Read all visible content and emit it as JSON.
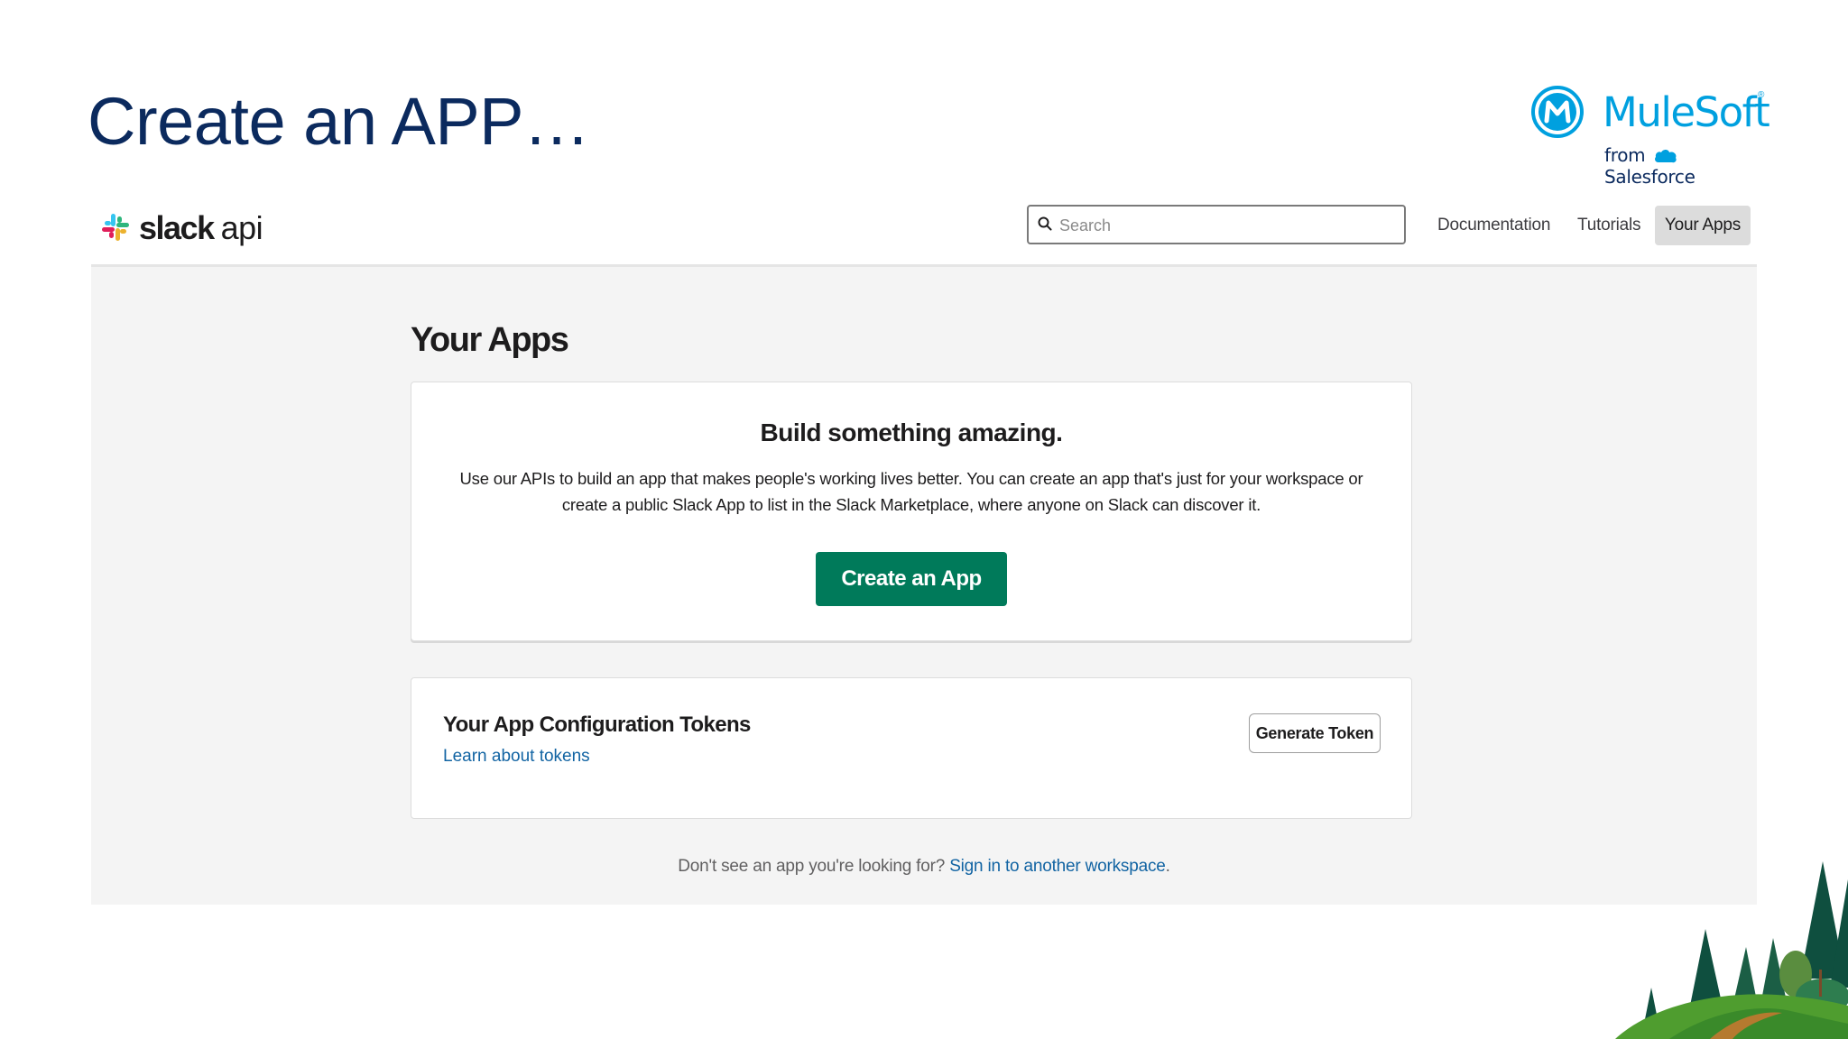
{
  "slide": {
    "title": "Create an APP…",
    "logo": {
      "name": "MuleSoft",
      "from_text": "from",
      "company": "Salesforce"
    }
  },
  "slack": {
    "brand": "slack",
    "brand_suffix": "api",
    "search": {
      "placeholder": "Search",
      "value": ""
    },
    "nav": {
      "documentation": "Documentation",
      "tutorials": "Tutorials",
      "your_apps": "Your Apps"
    },
    "page_title": "Your Apps",
    "build_card": {
      "heading": "Build something amazing.",
      "description": "Use our APIs to build an app that makes people's working lives better. You can create an app that's just for your workspace or create a public Slack App to list in the Slack Marketplace, where anyone on Slack can discover it.",
      "button": "Create an App"
    },
    "tokens_card": {
      "heading": "Your App Configuration Tokens",
      "link": "Learn about tokens",
      "button": "Generate Token"
    },
    "footer": {
      "text": "Don't see an app you're looking for?",
      "link": "Sign in to another workspace",
      "end": "."
    }
  },
  "colors": {
    "title": "#0b2a5e",
    "mulesoft_blue": "#00a0df",
    "primary_button": "#007a5a",
    "link": "#1264a3",
    "page_background": "#f4f4f4"
  }
}
